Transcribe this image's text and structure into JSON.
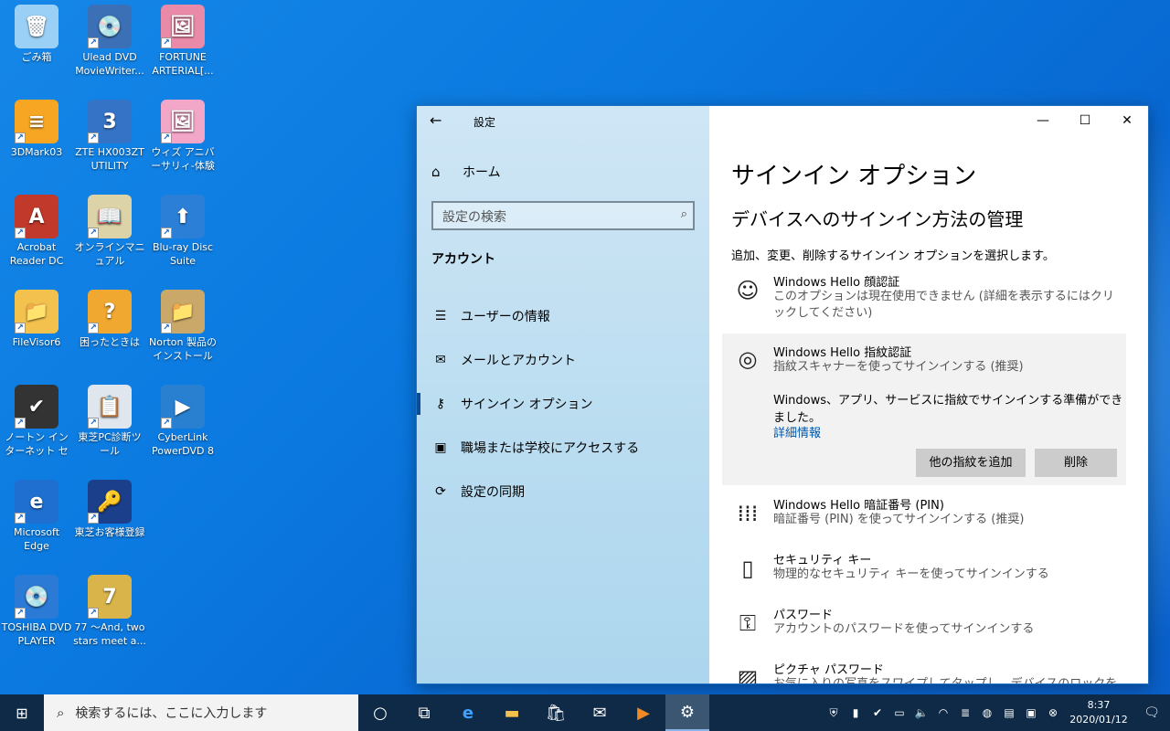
{
  "desktop": {
    "icons": [
      {
        "label": "ごみ箱",
        "glyph": "🗑"
      },
      {
        "label": "Ulead DVD MovieWriter...",
        "glyph": "💿"
      },
      {
        "label": "FORTUNE ARTERIAL[...",
        "glyph": "🖼"
      },
      {
        "label": "3DMark03",
        "glyph": "≡"
      },
      {
        "label": "ZTE HX003ZT UTILITY",
        "glyph": "3"
      },
      {
        "label": "ウィズ アニバーサリィ-体験版v...",
        "glyph": "🖼"
      },
      {
        "label": "Acrobat Reader DC",
        "glyph": "A"
      },
      {
        "label": "オンラインマニュアル",
        "glyph": "📖"
      },
      {
        "label": "Blu-ray Disc Suite",
        "glyph": "⬆"
      },
      {
        "label": "FileVisor6",
        "glyph": "📁"
      },
      {
        "label": "困ったときは",
        "glyph": "?"
      },
      {
        "label": "Norton 製品のインストールフ...",
        "glyph": "📁"
      },
      {
        "label": "ノートン インターネット セキュリ...",
        "glyph": "✔"
      },
      {
        "label": "東芝PC診断ツール",
        "glyph": "📋"
      },
      {
        "label": "CyberLink PowerDVD 8",
        "glyph": "▶"
      },
      {
        "label": "Microsoft Edge",
        "glyph": "e"
      },
      {
        "label": "東芝お客様登録",
        "glyph": "🔑"
      },
      {
        "label": "TOSHIBA DVD PLAYER",
        "glyph": "💿"
      },
      {
        "label": "77 ～And, two stars meet a...",
        "glyph": "7"
      }
    ]
  },
  "window": {
    "title": "設定",
    "home_label": "ホーム",
    "search_placeholder": "設定の検索",
    "section_heading": "アカウント",
    "nav": [
      {
        "label": "ユーザーの情報",
        "icon": "person-icon",
        "glyph": "☰"
      },
      {
        "label": "メールとアカウント",
        "icon": "mail-icon",
        "glyph": "✉"
      },
      {
        "label": "サインイン オプション",
        "icon": "key-icon",
        "glyph": "⚷"
      },
      {
        "label": "職場または学校にアクセスする",
        "icon": "briefcase-icon",
        "glyph": "▣"
      },
      {
        "label": "設定の同期",
        "icon": "sync-icon",
        "glyph": "⟳"
      }
    ],
    "page_title": "サインイン オプション",
    "sub_title": "デバイスへのサインイン方法の管理",
    "description": "追加、変更、削除するサインイン オプションを選択します。",
    "options": {
      "face": {
        "name": "Windows Hello 顔認証",
        "desc": "このオプションは現在使用できません (詳細を表示するにはクリックしてください)"
      },
      "fingerprint": {
        "name": "Windows Hello 指紋認証",
        "desc": "指紋スキャナーを使ってサインインする (推奨)",
        "ready": "Windows、アプリ、サービスに指紋でサインインする準備ができました。",
        "link": "詳細情報",
        "add_button": "他の指紋を追加",
        "remove_button": "削除"
      },
      "pin": {
        "name": "Windows Hello 暗証番号 (PIN)",
        "desc": "暗証番号 (PIN) を使ってサインインする (推奨)"
      },
      "security_key": {
        "name": "セキュリティ キー",
        "desc": "物理的なセキュリティ キーを使ってサインインする"
      },
      "password": {
        "name": "パスワード",
        "desc": "アカウントのパスワードを使ってサインインする"
      },
      "picture": {
        "name": "ピクチャ パスワード",
        "desc": "お気に入りの写真をスワイプしてタップし、デバイスのロックを解除する"
      }
    }
  },
  "taskbar": {
    "search_placeholder": "検索するには、ここに入力します",
    "time": "8:37",
    "date": "2020/01/12"
  }
}
